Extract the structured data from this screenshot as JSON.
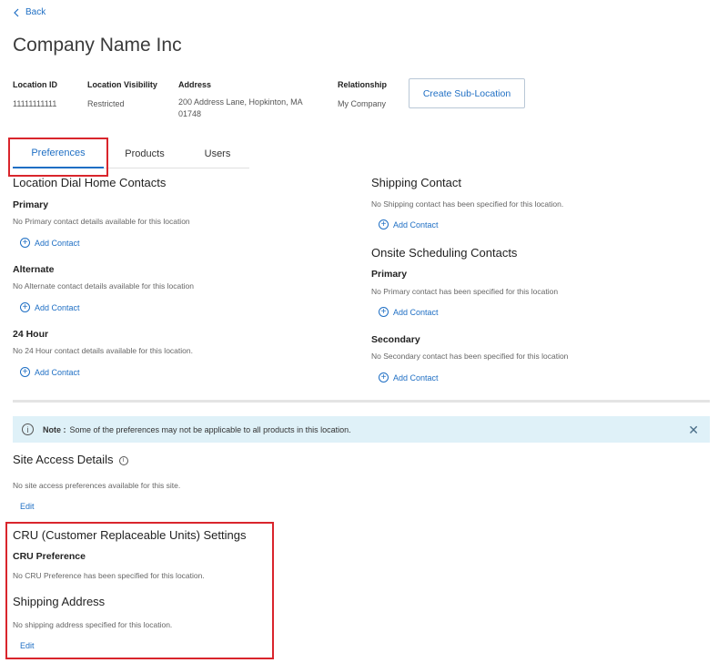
{
  "back": {
    "label": "Back"
  },
  "page": {
    "title": "Company Name Inc"
  },
  "meta": {
    "location_id": {
      "label": "Location ID",
      "value": "11111111111"
    },
    "visibility": {
      "label": "Location Visibility",
      "value": "Restricted"
    },
    "address": {
      "label": "Address",
      "line1": "200 Address Lane, Hopkinton, MA",
      "line2": "01748"
    },
    "relationship": {
      "label": "Relationship",
      "value": "My Company"
    }
  },
  "create_sub_location": "Create Sub-Location",
  "tabs": [
    {
      "label": "Preferences",
      "active": true
    },
    {
      "label": "Products"
    },
    {
      "label": "Users"
    }
  ],
  "left": {
    "heading": "Location Dial Home Contacts",
    "primary": {
      "title": "Primary",
      "msg": "No Primary contact details available for this location"
    },
    "alternate": {
      "title": "Alternate",
      "msg": "No Alternate contact details available for this location"
    },
    "hour24": {
      "title": "24 Hour",
      "msg": "No 24 Hour contact details available for this location."
    },
    "add_label": "Add Contact"
  },
  "right": {
    "shipping": {
      "heading": "Shipping Contact",
      "msg": "No Shipping contact has been specified for this location."
    },
    "onsite": {
      "heading": "Onsite Scheduling Contacts"
    },
    "primary": {
      "title": "Primary",
      "msg": "No Primary contact has been specified for this location"
    },
    "secondary": {
      "title": "Secondary",
      "msg": "No Secondary contact has been specified for this location"
    },
    "add_label": "Add Contact"
  },
  "note": {
    "bold": "Note :",
    "text": "Some of the preferences may not be applicable to all products in this location."
  },
  "site_access": {
    "heading": "Site Access Details",
    "msg": "No site access preferences available for this site.",
    "edit": "Edit"
  },
  "cru": {
    "heading": "CRU (Customer Replaceable Units) Settings",
    "pref_title": "CRU Preference",
    "pref_msg": "No CRU Preference has been specified for this location.",
    "ship_heading": "Shipping Address",
    "ship_msg": "No shipping address specified for this location.",
    "edit": "Edit"
  },
  "colors": {
    "accent": "#1f6fc4",
    "highlight": "#d9252c",
    "note_bg": "#dff1f8"
  }
}
